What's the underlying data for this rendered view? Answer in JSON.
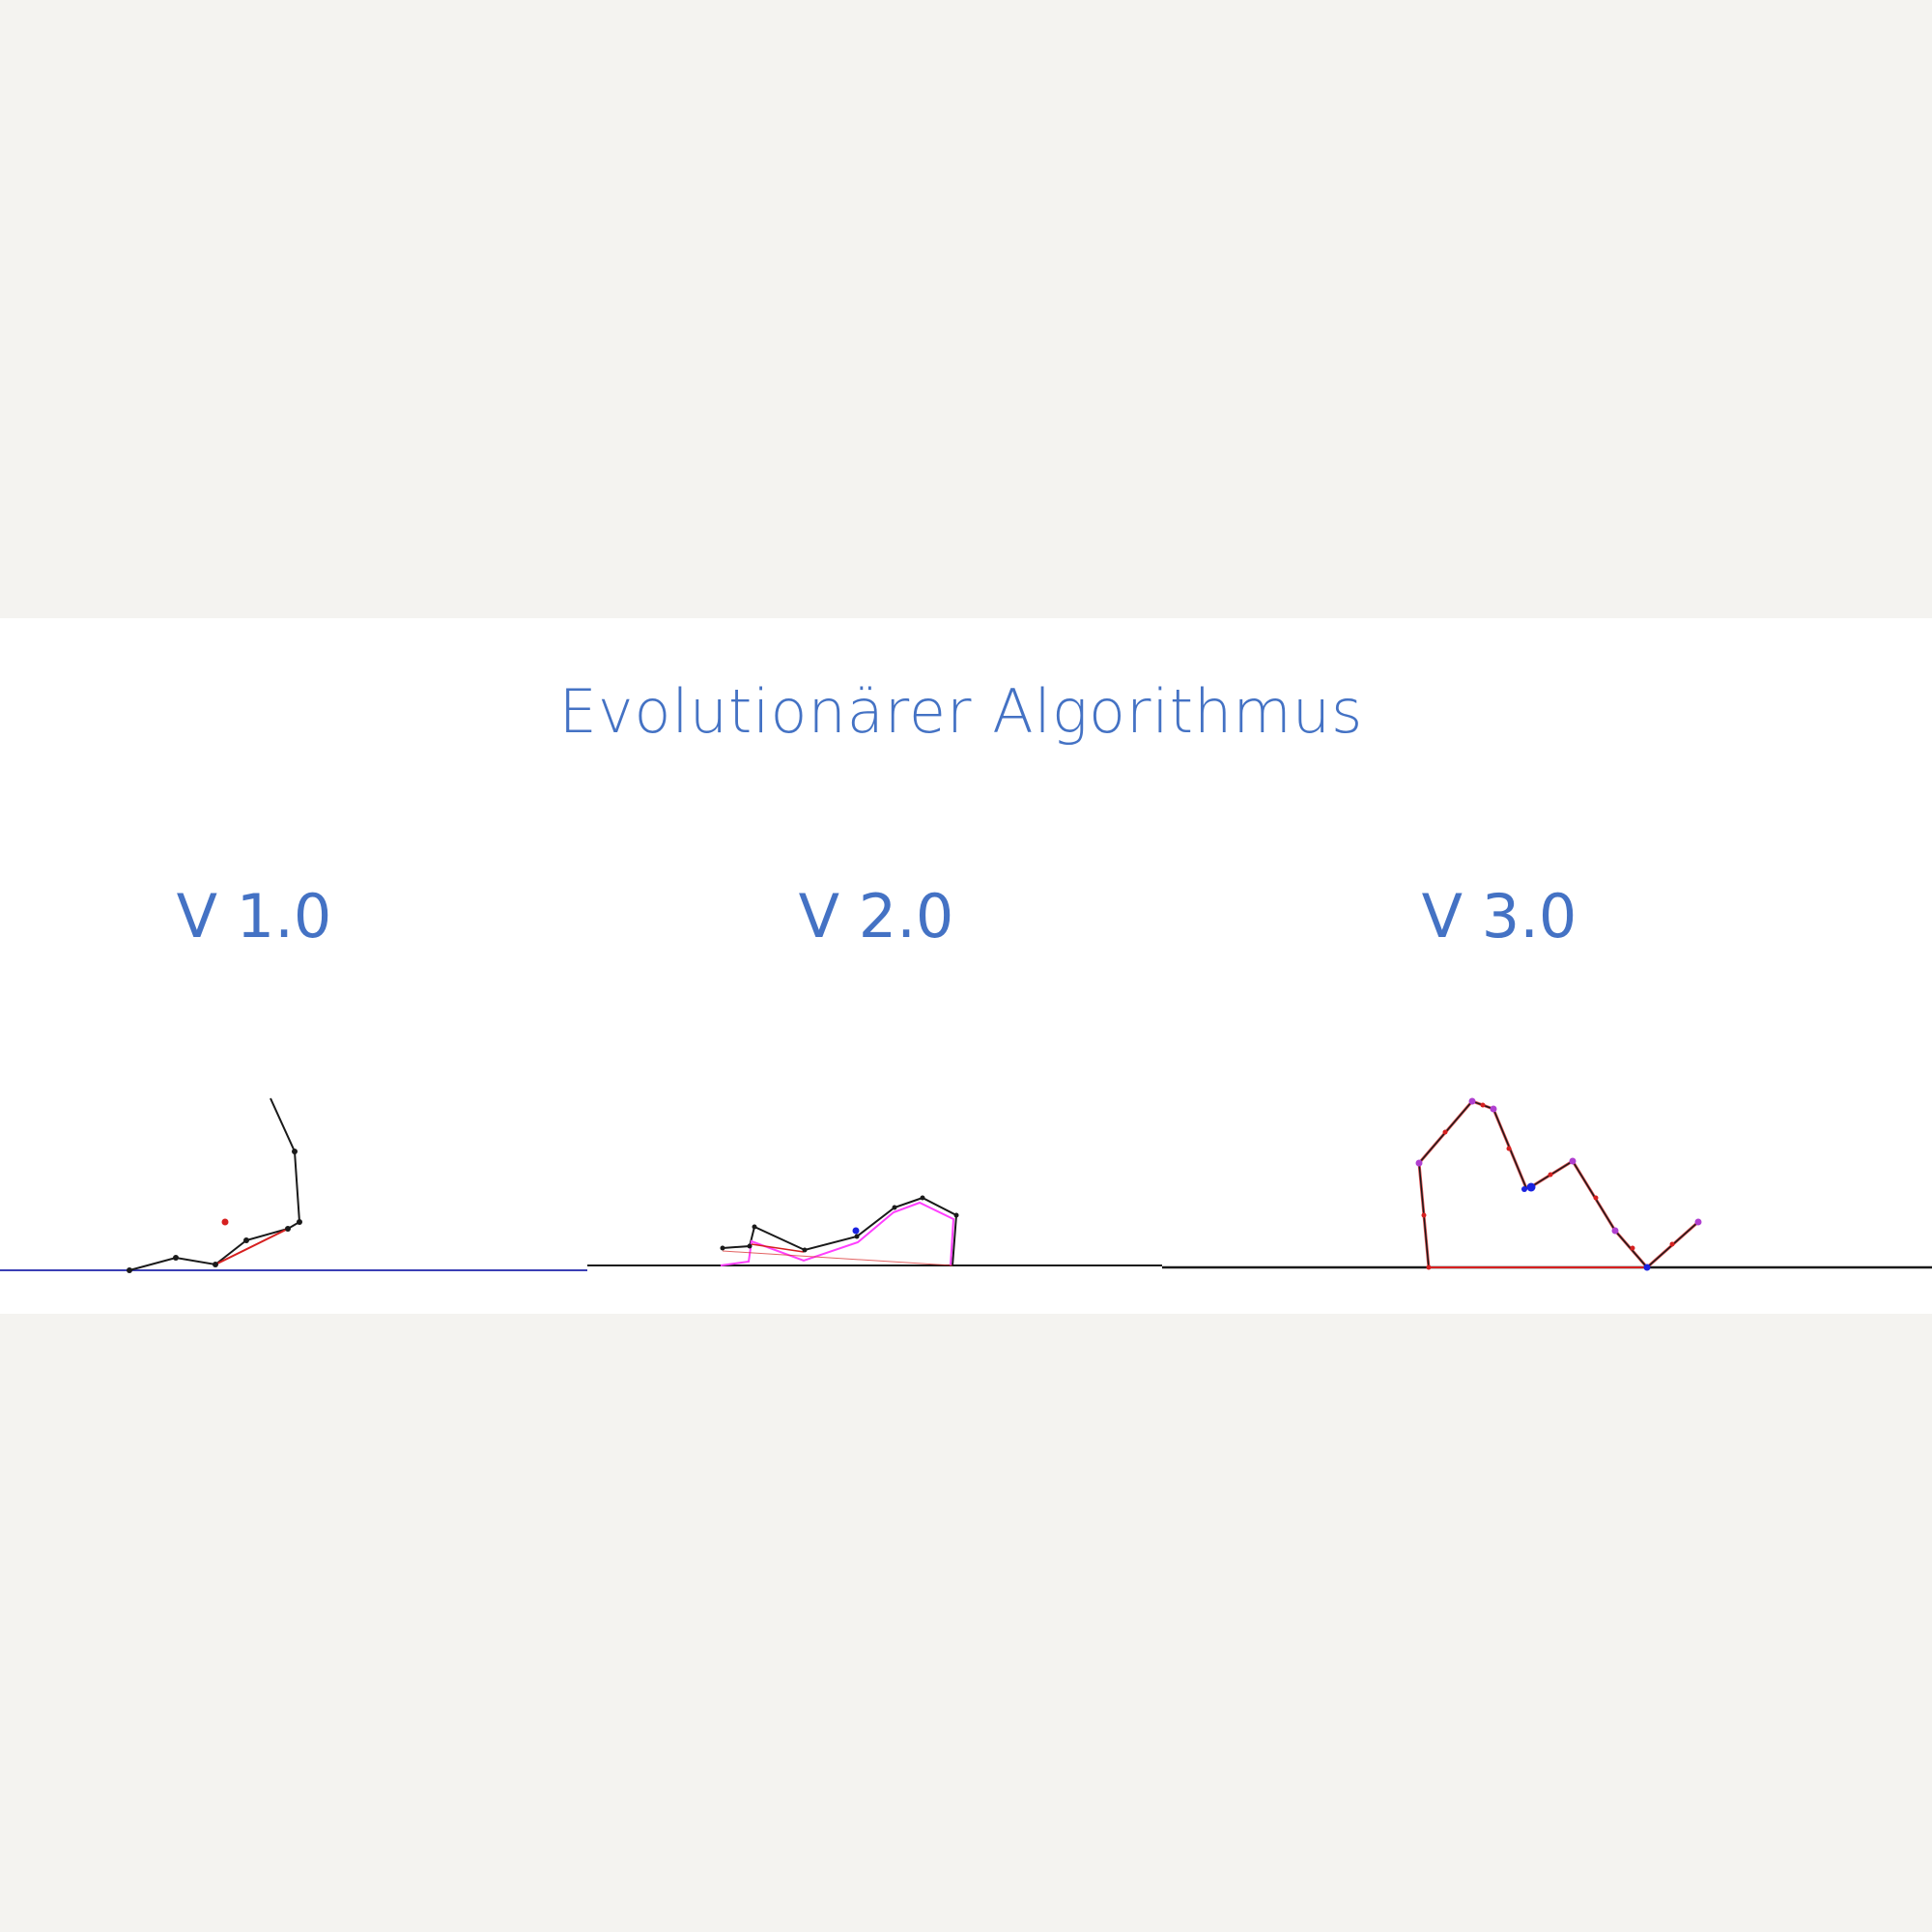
{
  "slide": {
    "title": "Evolutionärer Algorithmus",
    "versions": [
      {
        "label": "V 1.0"
      },
      {
        "label": "V 2.0"
      },
      {
        "label": "V 3.0"
      }
    ]
  },
  "colors": {
    "title": "#4472c4",
    "background": "#f4f3f0",
    "slide": "#ffffff",
    "ground_v1": "#3b3fb5",
    "ground": "#1a1a1a",
    "body": "#1a1a1a",
    "muscle": "#d62020",
    "outline": "#ff40ff",
    "center": "#1a22e0",
    "node_v3": "#b040d0"
  }
}
